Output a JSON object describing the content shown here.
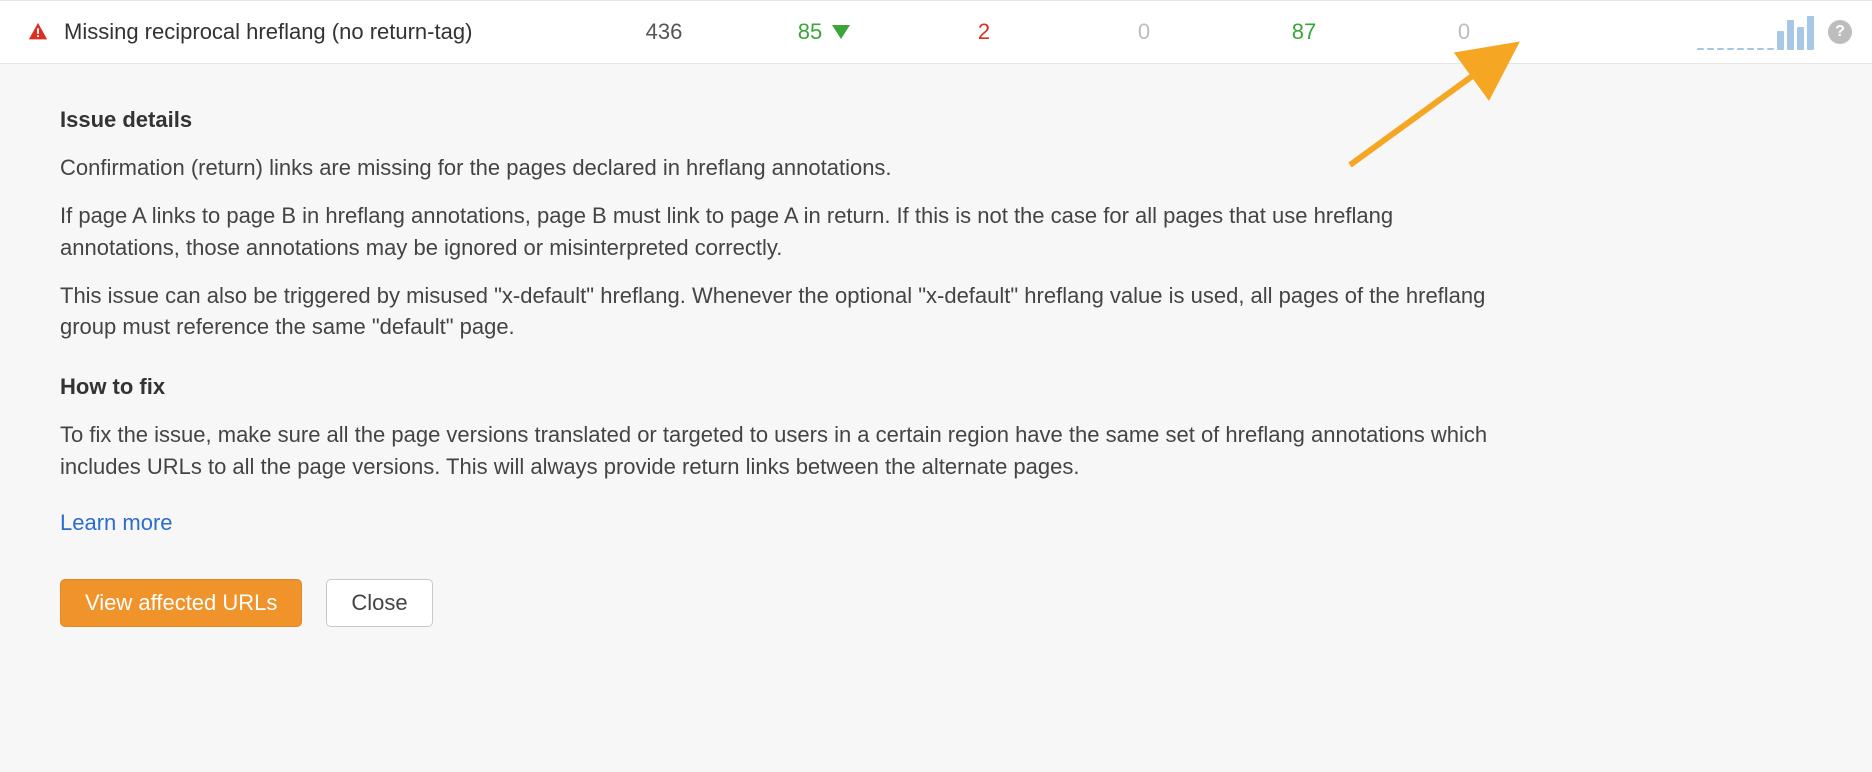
{
  "row": {
    "issue_name": "Missing reciprocal hreflang (no return-tag)",
    "total": "436",
    "added": "85",
    "new": "2",
    "zero1": "0",
    "green2": "87",
    "zero2": "0"
  },
  "sparkline": {
    "bars": [
      2,
      2,
      2,
      2,
      2,
      2,
      2,
      2,
      18,
      28,
      22,
      32
    ]
  },
  "details": {
    "heading": "Issue details",
    "p1": "Confirmation (return) links are missing for the pages declared in hreflang annotations.",
    "p2": "If page A links to page B in hreflang annotations, page B must link to page A in return. If this is not the case for all pages that use hreflang annotations, those annotations may be ignored or misinterpreted correctly.",
    "p3": "This issue can also be triggered by misused \"x-default\" hreflang. Whenever the optional \"x-default\" hreflang value is used, all pages of the hreflang group must reference the same \"default\" page.",
    "fix_heading": "How to fix",
    "fix_p1": "To fix the issue, make sure all the page versions translated or targeted to users in a certain region have the same set of hreflang annotations which includes URLs to all the page versions. This will always provide return links between the alternate pages.",
    "learn_more": "Learn more"
  },
  "buttons": {
    "view": "View affected URLs",
    "close": "Close"
  }
}
